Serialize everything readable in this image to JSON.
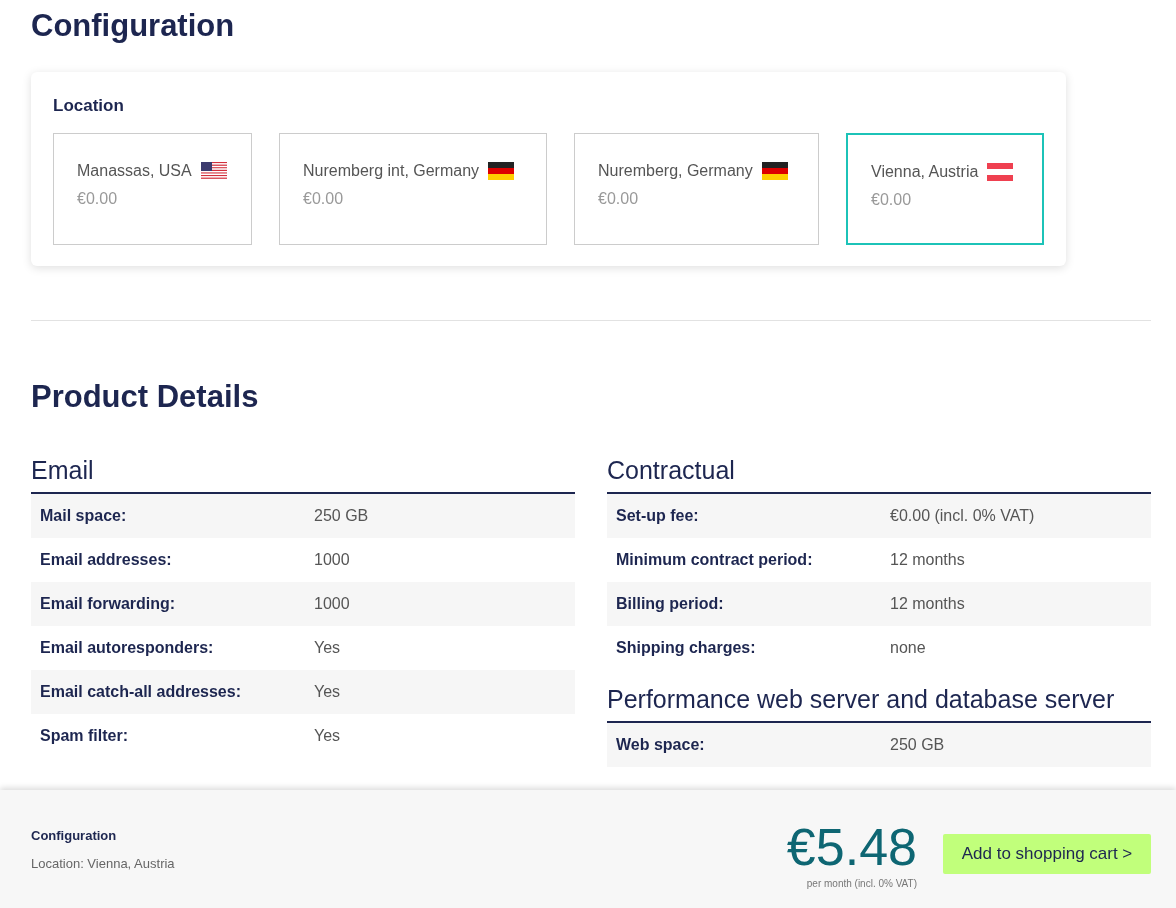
{
  "configuration": {
    "title": "Configuration",
    "location_label": "Location",
    "locations": [
      {
        "name": "Manassas, USA",
        "kind": "us",
        "price": "€0.00",
        "selected": false
      },
      {
        "name": "Nuremberg int, Germany",
        "kind": "de",
        "price": "€0.00",
        "selected": false
      },
      {
        "name": "Nuremberg, Germany",
        "kind": "de",
        "price": "€0.00",
        "selected": false
      },
      {
        "name": "Vienna, Austria",
        "kind": "at",
        "price": "€0.00",
        "selected": true
      }
    ]
  },
  "product_details": {
    "title": "Product Details",
    "columns": [
      {
        "sections": [
          {
            "title": "Email",
            "rows": [
              {
                "label": "Mail space:",
                "value": "250 GB"
              },
              {
                "label": "Email addresses:",
                "value": "1000"
              },
              {
                "label": "Email forwarding:",
                "value": "1000"
              },
              {
                "label": "Email autoresponders:",
                "value": "Yes"
              },
              {
                "label": "Email catch-all addresses:",
                "value": "Yes"
              },
              {
                "label": "Spam filter:",
                "value": "Yes"
              }
            ]
          }
        ]
      },
      {
        "sections": [
          {
            "title": "Contractual",
            "rows": [
              {
                "label": "Set-up fee:",
                "value": "€0.00 (incl. 0% VAT)"
              },
              {
                "label": "Minimum contract period:",
                "value": "12 months"
              },
              {
                "label": "Billing period:",
                "value": "12 months"
              },
              {
                "label": "Shipping charges:",
                "value": "none"
              }
            ]
          },
          {
            "title": "Performance web server and database server",
            "rows": [
              {
                "label": "Web space:",
                "value": "250 GB"
              }
            ]
          }
        ]
      }
    ]
  },
  "footer": {
    "title": "Configuration",
    "summary": "Location: Vienna, Austria",
    "price": "€5.48",
    "price_note": "per month (incl. 0% VAT)",
    "button": "Add to shopping cart >"
  }
}
